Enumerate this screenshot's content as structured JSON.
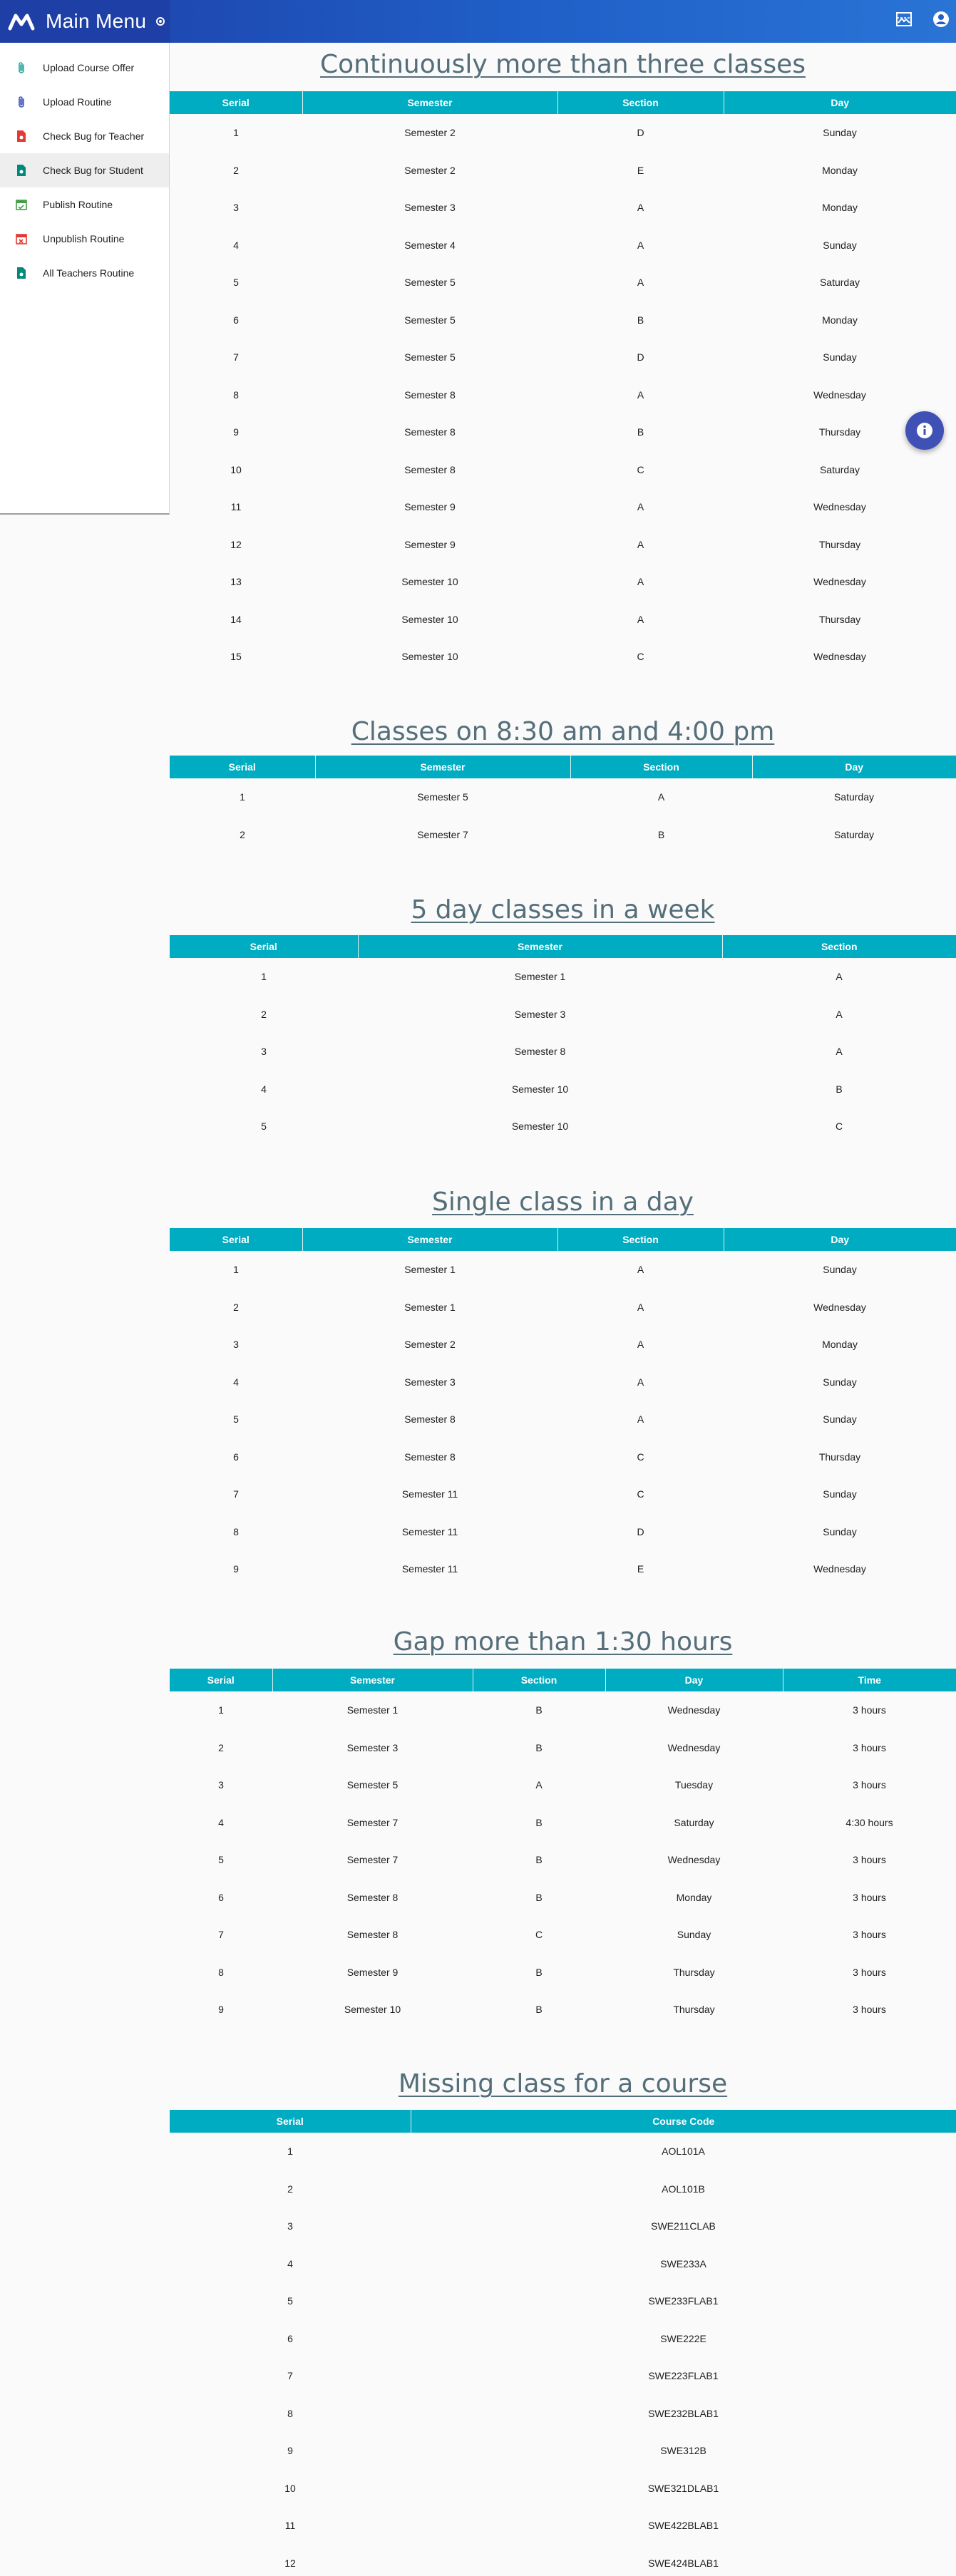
{
  "app": {
    "title": "Main Menu"
  },
  "sidebar": {
    "items": [
      {
        "label": "Upload Course Offer",
        "icon": "attachment-icon",
        "color": "#26a69a"
      },
      {
        "label": "Upload Routine",
        "icon": "attachment-icon",
        "color": "#3f51b5"
      },
      {
        "label": "Check Bug for Teacher",
        "icon": "file-bug-icon",
        "color": "#e53935"
      },
      {
        "label": "Check Bug for Student",
        "icon": "file-bug-icon",
        "color": "#00897b"
      },
      {
        "label": "Publish Routine",
        "icon": "calendar-check-icon",
        "color": "#43a047"
      },
      {
        "label": "Unpublish Routine",
        "icon": "calendar-remove-icon",
        "color": "#e53935"
      },
      {
        "label": "All Teachers Routine",
        "icon": "file-person-icon",
        "color": "#00897b"
      }
    ],
    "active_index": 3
  },
  "colors": {
    "header": "#1f4fb8",
    "table_header": "#00acc1",
    "title": "#546e7a",
    "fab": "#3f51b5"
  },
  "sections": [
    {
      "title": "Continuously more than three classes",
      "columns": [
        "Serial",
        "Semester",
        "Section",
        "Day"
      ],
      "rows": [
        [
          "1",
          "Semester 2",
          "D",
          "Sunday"
        ],
        [
          "2",
          "Semester 2",
          "E",
          "Monday"
        ],
        [
          "3",
          "Semester 3",
          "A",
          "Monday"
        ],
        [
          "4",
          "Semester 4",
          "A",
          "Sunday"
        ],
        [
          "5",
          "Semester 5",
          "A",
          "Saturday"
        ],
        [
          "6",
          "Semester 5",
          "B",
          "Monday"
        ],
        [
          "7",
          "Semester 5",
          "D",
          "Sunday"
        ],
        [
          "8",
          "Semester 8",
          "A",
          "Wednesday"
        ],
        [
          "9",
          "Semester 8",
          "B",
          "Thursday"
        ],
        [
          "10",
          "Semester 8",
          "C",
          "Saturday"
        ],
        [
          "11",
          "Semester 9",
          "A",
          "Wednesday"
        ],
        [
          "12",
          "Semester 9",
          "A",
          "Thursday"
        ],
        [
          "13",
          "Semester 10",
          "A",
          "Wednesday"
        ],
        [
          "14",
          "Semester 10",
          "A",
          "Thursday"
        ],
        [
          "15",
          "Semester 10",
          "C",
          "Wednesday"
        ]
      ]
    },
    {
      "title": "Classes on 8:30 am and 4:00 pm",
      "columns": [
        "Serial",
        "Semester",
        "Section",
        "Day"
      ],
      "rows": [
        [
          "1",
          "Semester 5",
          "A",
          "Saturday"
        ],
        [
          "2",
          "Semester 7",
          "B",
          "Saturday"
        ]
      ]
    },
    {
      "title": "5 day classes in a week",
      "columns": [
        "Serial",
        "Semester",
        "Section"
      ],
      "rows": [
        [
          "1",
          "Semester 1",
          "A"
        ],
        [
          "2",
          "Semester 3",
          "A"
        ],
        [
          "3",
          "Semester 8",
          "A"
        ],
        [
          "4",
          "Semester 10",
          "B"
        ],
        [
          "5",
          "Semester 10",
          "C"
        ]
      ]
    },
    {
      "title": "Single class in a day",
      "columns": [
        "Serial",
        "Semester",
        "Section",
        "Day"
      ],
      "rows": [
        [
          "1",
          "Semester 1",
          "A",
          "Sunday"
        ],
        [
          "2",
          "Semester 1",
          "A",
          "Wednesday"
        ],
        [
          "3",
          "Semester 2",
          "A",
          "Monday"
        ],
        [
          "4",
          "Semester 3",
          "A",
          "Sunday"
        ],
        [
          "5",
          "Semester 8",
          "A",
          "Sunday"
        ],
        [
          "6",
          "Semester 8",
          "C",
          "Thursday"
        ],
        [
          "7",
          "Semester 11",
          "C",
          "Sunday"
        ],
        [
          "8",
          "Semester 11",
          "D",
          "Sunday"
        ],
        [
          "9",
          "Semester 11",
          "E",
          "Wednesday"
        ]
      ]
    },
    {
      "title": "Gap more than 1:30 hours",
      "columns": [
        "Serial",
        "Semester",
        "Section",
        "Day",
        "Time"
      ],
      "rows": [
        [
          "1",
          "Semester 1",
          "B",
          "Wednesday",
          "3 hours"
        ],
        [
          "2",
          "Semester 3",
          "B",
          "Wednesday",
          "3 hours"
        ],
        [
          "3",
          "Semester 5",
          "A",
          "Tuesday",
          "3 hours"
        ],
        [
          "4",
          "Semester 7",
          "B",
          "Saturday",
          "4:30 hours"
        ],
        [
          "5",
          "Semester 7",
          "B",
          "Wednesday",
          "3 hours"
        ],
        [
          "6",
          "Semester 8",
          "B",
          "Monday",
          "3 hours"
        ],
        [
          "7",
          "Semester 8",
          "C",
          "Sunday",
          "3 hours"
        ],
        [
          "8",
          "Semester 9",
          "B",
          "Thursday",
          "3 hours"
        ],
        [
          "9",
          "Semester 10",
          "B",
          "Thursday",
          "3 hours"
        ]
      ]
    },
    {
      "title": "Missing class for a course",
      "columns": [
        "Serial",
        "Course Code"
      ],
      "rows": [
        [
          "1",
          "AOL101A"
        ],
        [
          "2",
          "AOL101B"
        ],
        [
          "3",
          "SWE211CLAB"
        ],
        [
          "4",
          "SWE233A"
        ],
        [
          "5",
          "SWE233FLAB1"
        ],
        [
          "6",
          "SWE222E"
        ],
        [
          "7",
          "SWE223FLAB1"
        ],
        [
          "8",
          "SWE232BLAB1"
        ],
        [
          "9",
          "SWE312B"
        ],
        [
          "10",
          "SWE321DLAB1"
        ],
        [
          "11",
          "SWE422BLAB1"
        ],
        [
          "12",
          "SWE424BLAB1"
        ]
      ]
    }
  ]
}
